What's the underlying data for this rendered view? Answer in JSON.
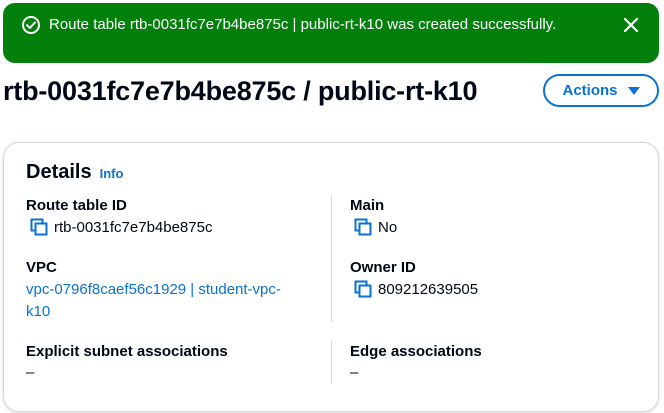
{
  "flash": {
    "message": "Route table rtb-0031fc7e7b4be875c | public-rt-k10 was created successfully.",
    "type": "success",
    "color": "#037f0c",
    "icon": "check-circle-icon",
    "close_icon": "close-icon"
  },
  "page": {
    "title": "rtb-0031fc7e7b4be875c / public-rt-k10",
    "actions_label": "Actions",
    "accent": "#0972d3"
  },
  "details": {
    "heading": "Details",
    "info_label": "Info",
    "fields": {
      "route_table_id_label": "Route table ID",
      "route_table_id_value": "rtb-0031fc7e7b4be875c",
      "main_label": "Main",
      "main_value": "No",
      "vpc_label": "VPC",
      "vpc_line1": "vpc-0796f8caef56c1929 | student-vpc-",
      "vpc_line2": "k10",
      "owner_id_label": "Owner ID",
      "owner_id_value": "809212639505",
      "explicit_subnet_label": "Explicit subnet associations",
      "explicit_subnet_value": "–",
      "edge_assoc_label": "Edge associations",
      "edge_assoc_value": "–"
    }
  }
}
